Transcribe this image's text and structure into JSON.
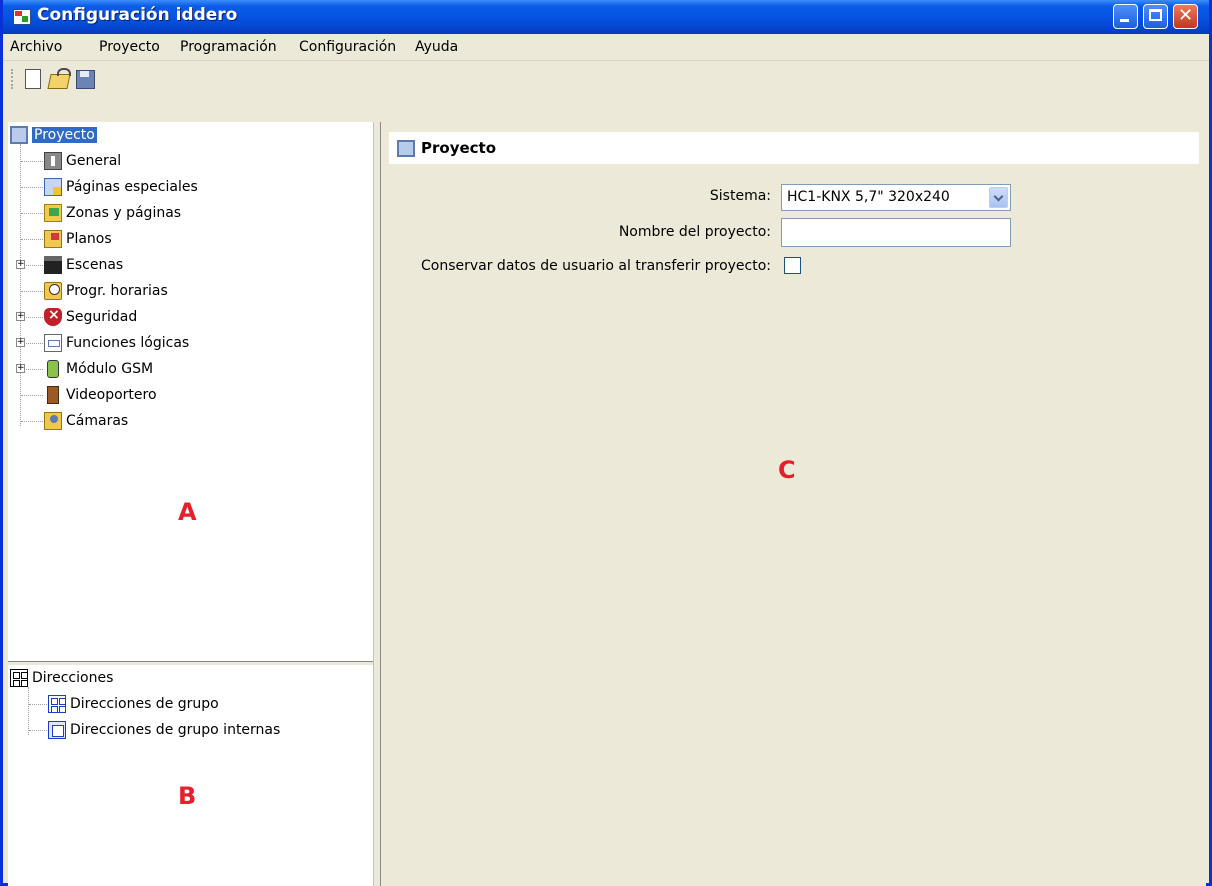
{
  "window": {
    "title": "Configuración iddero"
  },
  "menu": [
    "Archivo",
    "Proyecto",
    "Programación",
    "Configuración",
    "Ayuda"
  ],
  "toolbar": {
    "icons": [
      "new-document-icon",
      "open-folder-icon",
      "save-disk-icon"
    ]
  },
  "tree_a": {
    "root": "Proyecto",
    "items": [
      {
        "label": "General",
        "icon": "info-icon"
      },
      {
        "label": "Páginas especiales",
        "icon": "special-pages-icon"
      },
      {
        "label": "Zonas y páginas",
        "icon": "zones-pages-icon"
      },
      {
        "label": "Planos",
        "icon": "plans-icon"
      },
      {
        "label": "Escenas",
        "icon": "clapperboard-icon",
        "expandable": true
      },
      {
        "label": "Progr. horarias",
        "icon": "clock-folder-icon"
      },
      {
        "label": "Seguridad",
        "icon": "shield-icon",
        "expandable": true
      },
      {
        "label": "Funciones lógicas",
        "icon": "logic-function-icon",
        "expandable": true
      },
      {
        "label": "Módulo GSM",
        "icon": "mobile-phone-icon",
        "expandable": true
      },
      {
        "label": "Videoportero",
        "icon": "door-icon"
      },
      {
        "label": "Cámaras",
        "icon": "camera-folder-icon"
      }
    ]
  },
  "tree_b": {
    "root": "Direcciones",
    "items": [
      {
        "label": "Direcciones de grupo",
        "icon": "group-address-icon"
      },
      {
        "label": "Direcciones de grupo internas",
        "icon": "internal-group-address-icon"
      }
    ]
  },
  "markers": {
    "a": "A",
    "b": "B",
    "c": "C"
  },
  "panel": {
    "title": "Proyecto",
    "sistema_label": "Sistema:",
    "sistema_value": "HC1-KNX 5,7\" 320x240",
    "nombre_label": "Nombre del proyecto:",
    "nombre_value": "",
    "conservar_label": "Conservar datos de usuario al transferir proyecto:",
    "conservar_checked": false
  },
  "colors": {
    "titlebar": "#0552e0",
    "selection": "#316ac5",
    "marker": "#e5202a",
    "background": "#ece9d8"
  }
}
